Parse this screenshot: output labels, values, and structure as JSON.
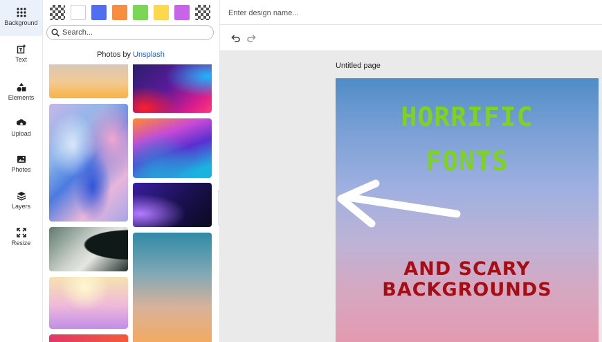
{
  "rail": {
    "items": [
      {
        "label": "Background",
        "icon": "grid-dots-icon"
      },
      {
        "label": "Text",
        "icon": "text-add-icon"
      },
      {
        "label": "Elements",
        "icon": "shapes-icon"
      },
      {
        "label": "Upload",
        "icon": "upload-icon"
      },
      {
        "label": "Photos",
        "icon": "image-icon"
      },
      {
        "label": "Layers",
        "icon": "layers-icon"
      },
      {
        "label": "Resize",
        "icon": "resize-icon"
      }
    ]
  },
  "panel": {
    "swatches": [
      "transparent",
      "#ffffff",
      "#4f6ef0",
      "#f98d3f",
      "#7ad756",
      "#fdd84d",
      "#c864e8",
      "transparent"
    ],
    "search_placeholder": "Search...",
    "credit_prefix": "Photos by ",
    "credit_link": "Unsplash"
  },
  "topbar": {
    "design_name_placeholder": "Enter design name..."
  },
  "toolbar": {
    "undo_icon": "undo-icon",
    "redo_icon": "redo-icon"
  },
  "workspace": {
    "page_title": "Untitled page"
  },
  "canvas": {
    "line1": "HORRIFIC",
    "line2": "FONTS",
    "line3": "AND SCARY",
    "line4": "BACKGROUNDS",
    "title_color": "#7ed321",
    "subtitle_color": "#a50e14"
  }
}
